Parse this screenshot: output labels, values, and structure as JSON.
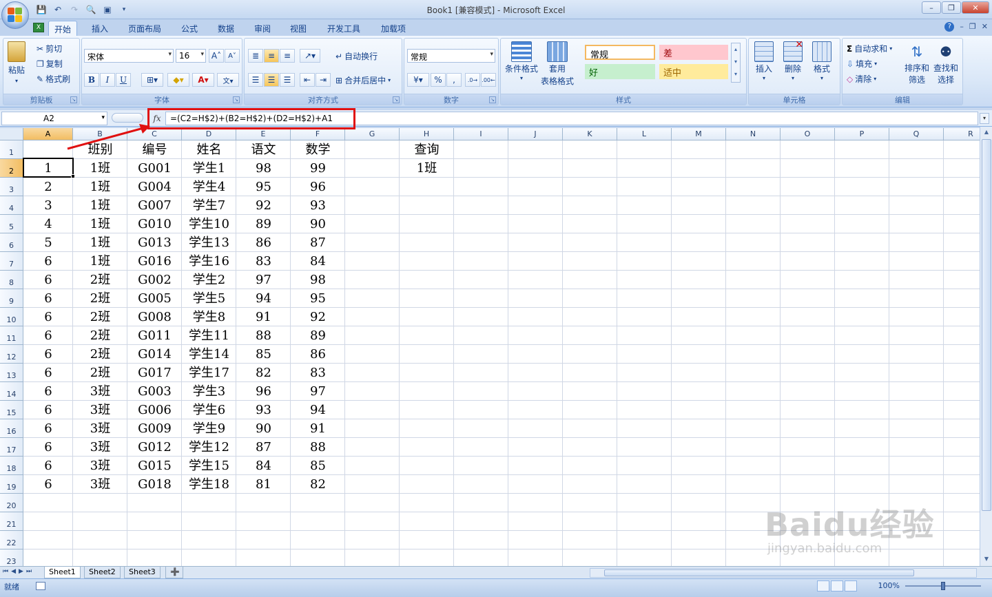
{
  "window": {
    "title": "Book1  [兼容模式] - Microsoft Excel"
  },
  "tabs": [
    "开始",
    "插入",
    "页面布局",
    "公式",
    "数据",
    "审阅",
    "视图",
    "开发工具",
    "加载项"
  ],
  "ribbon": {
    "clipboard": {
      "paste": "粘贴",
      "cut": "剪切",
      "copy": "复制",
      "format_painter": "格式刷",
      "label": "剪贴板"
    },
    "font": {
      "name": "宋体",
      "size": "16",
      "label": "字体",
      "bold": "B",
      "italic": "I",
      "underline": "U"
    },
    "alignment": {
      "wrap": "自动换行",
      "merge": "合并后居中",
      "label": "对齐方式"
    },
    "number": {
      "format": "常规",
      "label": "数字",
      "percent": "%",
      "comma": ","
    },
    "styles": {
      "conditional": "条件格式",
      "table1": "套用",
      "table2": "表格格式",
      "normal": "常规",
      "bad": "差",
      "good": "好",
      "neutral": "适中",
      "label": "样式"
    },
    "cells": {
      "insert": "插入",
      "delete": "删除",
      "format": "格式",
      "label": "单元格"
    },
    "editing": {
      "autosum": "自动求和",
      "fill": "填充",
      "clear": "清除",
      "sort1": "排序和",
      "sort2": "筛选",
      "find1": "查找和",
      "find2": "选择",
      "label": "编辑"
    }
  },
  "formula_bar": {
    "name_box": "A2",
    "fx": "fx",
    "formula": "=(C2=H$2)+(B2=H$2)+(D2=H$2)+A1"
  },
  "columns": [
    "A",
    "B",
    "C",
    "D",
    "E",
    "F",
    "G",
    "H",
    "I",
    "J",
    "K",
    "L",
    "M",
    "N",
    "O",
    "P",
    "Q",
    "R"
  ],
  "rows": [
    [
      "",
      "班别",
      "编号",
      "姓名",
      "语文",
      "数学",
      "",
      "查询"
    ],
    [
      "1",
      "1班",
      "G001",
      "学生1",
      "98",
      "99",
      "",
      "1班"
    ],
    [
      "2",
      "1班",
      "G004",
      "学生4",
      "95",
      "96"
    ],
    [
      "3",
      "1班",
      "G007",
      "学生7",
      "92",
      "93"
    ],
    [
      "4",
      "1班",
      "G010",
      "学生10",
      "89",
      "90"
    ],
    [
      "5",
      "1班",
      "G013",
      "学生13",
      "86",
      "87"
    ],
    [
      "6",
      "1班",
      "G016",
      "学生16",
      "83",
      "84"
    ],
    [
      "6",
      "2班",
      "G002",
      "学生2",
      "97",
      "98"
    ],
    [
      "6",
      "2班",
      "G005",
      "学生5",
      "94",
      "95"
    ],
    [
      "6",
      "2班",
      "G008",
      "学生8",
      "91",
      "92"
    ],
    [
      "6",
      "2班",
      "G011",
      "学生11",
      "88",
      "89"
    ],
    [
      "6",
      "2班",
      "G014",
      "学生14",
      "85",
      "86"
    ],
    [
      "6",
      "2班",
      "G017",
      "学生17",
      "82",
      "83"
    ],
    [
      "6",
      "3班",
      "G003",
      "学生3",
      "96",
      "97"
    ],
    [
      "6",
      "3班",
      "G006",
      "学生6",
      "93",
      "94"
    ],
    [
      "6",
      "3班",
      "G009",
      "学生9",
      "90",
      "91"
    ],
    [
      "6",
      "3班",
      "G012",
      "学生12",
      "87",
      "88"
    ],
    [
      "6",
      "3班",
      "G015",
      "学生15",
      "84",
      "85"
    ],
    [
      "6",
      "3班",
      "G018",
      "学生18",
      "81",
      "82"
    ],
    [],
    [],
    [],
    []
  ],
  "sheets": [
    "Sheet1",
    "Sheet2",
    "Sheet3"
  ],
  "active_sheet": "Sheet1",
  "status": {
    "ready": "就绪",
    "zoom": "100%"
  },
  "watermark": {
    "brand": "Baidu经验",
    "url": "jingyan.baidu.com"
  },
  "colors": {
    "annotation": "#e01010",
    "selection": "#f2bd62"
  }
}
